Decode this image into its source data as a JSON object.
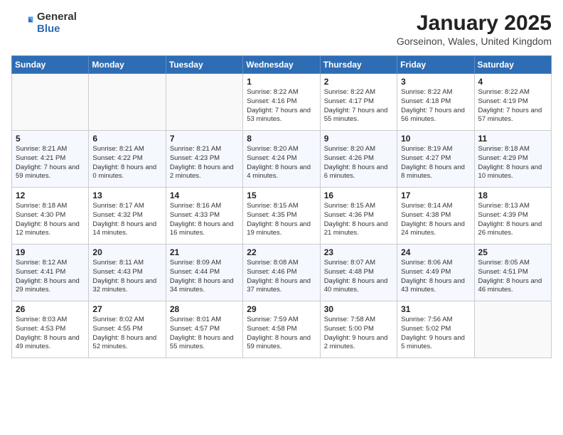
{
  "logo": {
    "general": "General",
    "blue": "Blue"
  },
  "title": "January 2025",
  "subtitle": "Gorseinon, Wales, United Kingdom",
  "days_of_week": [
    "Sunday",
    "Monday",
    "Tuesday",
    "Wednesday",
    "Thursday",
    "Friday",
    "Saturday"
  ],
  "weeks": [
    [
      {
        "day": "",
        "info": ""
      },
      {
        "day": "",
        "info": ""
      },
      {
        "day": "",
        "info": ""
      },
      {
        "day": "1",
        "info": "Sunrise: 8:22 AM\nSunset: 4:16 PM\nDaylight: 7 hours and 53 minutes."
      },
      {
        "day": "2",
        "info": "Sunrise: 8:22 AM\nSunset: 4:17 PM\nDaylight: 7 hours and 55 minutes."
      },
      {
        "day": "3",
        "info": "Sunrise: 8:22 AM\nSunset: 4:18 PM\nDaylight: 7 hours and 56 minutes."
      },
      {
        "day": "4",
        "info": "Sunrise: 8:22 AM\nSunset: 4:19 PM\nDaylight: 7 hours and 57 minutes."
      }
    ],
    [
      {
        "day": "5",
        "info": "Sunrise: 8:21 AM\nSunset: 4:21 PM\nDaylight: 7 hours and 59 minutes."
      },
      {
        "day": "6",
        "info": "Sunrise: 8:21 AM\nSunset: 4:22 PM\nDaylight: 8 hours and 0 minutes."
      },
      {
        "day": "7",
        "info": "Sunrise: 8:21 AM\nSunset: 4:23 PM\nDaylight: 8 hours and 2 minutes."
      },
      {
        "day": "8",
        "info": "Sunrise: 8:20 AM\nSunset: 4:24 PM\nDaylight: 8 hours and 4 minutes."
      },
      {
        "day": "9",
        "info": "Sunrise: 8:20 AM\nSunset: 4:26 PM\nDaylight: 8 hours and 6 minutes."
      },
      {
        "day": "10",
        "info": "Sunrise: 8:19 AM\nSunset: 4:27 PM\nDaylight: 8 hours and 8 minutes."
      },
      {
        "day": "11",
        "info": "Sunrise: 8:18 AM\nSunset: 4:29 PM\nDaylight: 8 hours and 10 minutes."
      }
    ],
    [
      {
        "day": "12",
        "info": "Sunrise: 8:18 AM\nSunset: 4:30 PM\nDaylight: 8 hours and 12 minutes."
      },
      {
        "day": "13",
        "info": "Sunrise: 8:17 AM\nSunset: 4:32 PM\nDaylight: 8 hours and 14 minutes."
      },
      {
        "day": "14",
        "info": "Sunrise: 8:16 AM\nSunset: 4:33 PM\nDaylight: 8 hours and 16 minutes."
      },
      {
        "day": "15",
        "info": "Sunrise: 8:15 AM\nSunset: 4:35 PM\nDaylight: 8 hours and 19 minutes."
      },
      {
        "day": "16",
        "info": "Sunrise: 8:15 AM\nSunset: 4:36 PM\nDaylight: 8 hours and 21 minutes."
      },
      {
        "day": "17",
        "info": "Sunrise: 8:14 AM\nSunset: 4:38 PM\nDaylight: 8 hours and 24 minutes."
      },
      {
        "day": "18",
        "info": "Sunrise: 8:13 AM\nSunset: 4:39 PM\nDaylight: 8 hours and 26 minutes."
      }
    ],
    [
      {
        "day": "19",
        "info": "Sunrise: 8:12 AM\nSunset: 4:41 PM\nDaylight: 8 hours and 29 minutes."
      },
      {
        "day": "20",
        "info": "Sunrise: 8:11 AM\nSunset: 4:43 PM\nDaylight: 8 hours and 32 minutes."
      },
      {
        "day": "21",
        "info": "Sunrise: 8:09 AM\nSunset: 4:44 PM\nDaylight: 8 hours and 34 minutes."
      },
      {
        "day": "22",
        "info": "Sunrise: 8:08 AM\nSunset: 4:46 PM\nDaylight: 8 hours and 37 minutes."
      },
      {
        "day": "23",
        "info": "Sunrise: 8:07 AM\nSunset: 4:48 PM\nDaylight: 8 hours and 40 minutes."
      },
      {
        "day": "24",
        "info": "Sunrise: 8:06 AM\nSunset: 4:49 PM\nDaylight: 8 hours and 43 minutes."
      },
      {
        "day": "25",
        "info": "Sunrise: 8:05 AM\nSunset: 4:51 PM\nDaylight: 8 hours and 46 minutes."
      }
    ],
    [
      {
        "day": "26",
        "info": "Sunrise: 8:03 AM\nSunset: 4:53 PM\nDaylight: 8 hours and 49 minutes."
      },
      {
        "day": "27",
        "info": "Sunrise: 8:02 AM\nSunset: 4:55 PM\nDaylight: 8 hours and 52 minutes."
      },
      {
        "day": "28",
        "info": "Sunrise: 8:01 AM\nSunset: 4:57 PM\nDaylight: 8 hours and 55 minutes."
      },
      {
        "day": "29",
        "info": "Sunrise: 7:59 AM\nSunset: 4:58 PM\nDaylight: 8 hours and 59 minutes."
      },
      {
        "day": "30",
        "info": "Sunrise: 7:58 AM\nSunset: 5:00 PM\nDaylight: 9 hours and 2 minutes."
      },
      {
        "day": "31",
        "info": "Sunrise: 7:56 AM\nSunset: 5:02 PM\nDaylight: 9 hours and 5 minutes."
      },
      {
        "day": "",
        "info": ""
      }
    ]
  ]
}
